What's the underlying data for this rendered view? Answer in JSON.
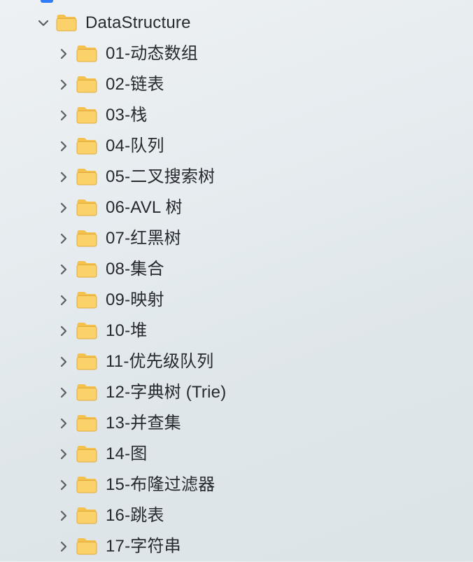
{
  "tree": {
    "root": {
      "label": "DataStructure",
      "expanded": true,
      "icon": "folder-icon",
      "children": [
        {
          "label": "01-动态数组"
        },
        {
          "label": "02-链表"
        },
        {
          "label": "03-栈"
        },
        {
          "label": "04-队列"
        },
        {
          "label": "05-二叉搜索树"
        },
        {
          "label": "06-AVL 树"
        },
        {
          "label": "07-红黑树"
        },
        {
          "label": "08-集合"
        },
        {
          "label": "09-映射"
        },
        {
          "label": "10-堆"
        },
        {
          "label": "11-优先级队列"
        },
        {
          "label": "12-字典树 (Trie)"
        },
        {
          "label": "13-并查集"
        },
        {
          "label": "14-图"
        },
        {
          "label": "15-布隆过滤器"
        },
        {
          "label": "16-跳表"
        },
        {
          "label": "17-字符串"
        }
      ]
    }
  },
  "colors": {
    "folder_body": "#fbd26a",
    "folder_back": "#f4c04e",
    "folder_edge": "#e2a93a",
    "chevron": "#5a5f66",
    "selection_mark": "#2f7cf6"
  }
}
